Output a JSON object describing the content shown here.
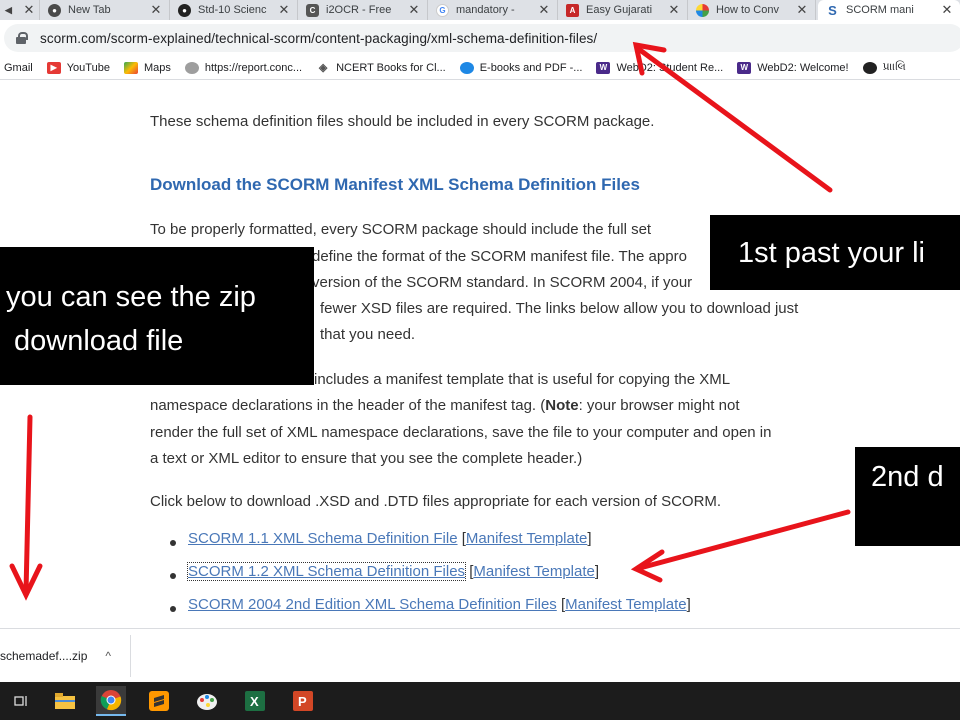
{
  "browser": {
    "tabs": [
      {
        "label": "",
        "icon": "tab-audio-icon",
        "close": "✕"
      },
      {
        "label": "New Tab",
        "icon": "chrome-icon",
        "close": "✕"
      },
      {
        "label": "Std-10 Scienc",
        "icon": "github-icon",
        "close": "✕"
      },
      {
        "label": "i2OCR - Free",
        "icon": "i2ocr-icon",
        "close": "✕"
      },
      {
        "label": "mandatory - ",
        "icon": "google-icon",
        "close": "✕"
      },
      {
        "label": "Easy Gujarati",
        "icon": "easy-gujarati-icon",
        "close": "✕"
      },
      {
        "label": "How to Conv",
        "icon": "pinwheel-icon",
        "close": "✕"
      },
      {
        "label": "SCORM mani",
        "icon": "scorm-icon",
        "close": "✕"
      }
    ],
    "url": "scorm.com/scorm-explained/technical-scorm/content-packaging/xml-schema-definition-files/",
    "bookmarks": [
      {
        "label": "Gmail",
        "icon": "gmail-icon"
      },
      {
        "label": "YouTube",
        "icon": "youtube-icon"
      },
      {
        "label": "Maps",
        "icon": "maps-icon"
      },
      {
        "label": "https://report.conc...",
        "icon": "globe-icon"
      },
      {
        "label": "NCERT Books for Cl...",
        "icon": "ncert-icon"
      },
      {
        "label": "E-books and PDF -...",
        "icon": "ebook-icon"
      },
      {
        "label": "WebD2: Student Re...",
        "icon": "webd2-icon"
      },
      {
        "label": "WebD2: Welcome!",
        "icon": "webd2-icon"
      },
      {
        "label": "પ્રાાલિ",
        "icon": "github-icon"
      }
    ]
  },
  "page": {
    "intro": "These schema definition files should be included in every SCORM package.",
    "heading": "Download the SCORM Manifest XML Schema Definition Files",
    "p1_lines": [
      "To be properly formatted, every SCORM package should include the full set",
      "define the format of the SCORM manifest file. The appro",
      "version of the SCORM standard. In SCORM 2004, if your",
      "fewer XSD files are required. The links below allow you to download just",
      "that you need."
    ],
    "p2_lines": [
      "includes a manifest template that is useful for copying the XML",
      "namespace declarations in the header of the manifest tag. (",
      "Note",
      ": your browser might not",
      "render the full set of XML namespace declarations, save the file to your computer and open in",
      "a text or XML editor to ensure that you see the complete header.)"
    ],
    "p3": "Click below to download .XSD and .DTD files appropriate for each version of SCORM.",
    "links": [
      {
        "main": "SCORM 1.1 XML Schema Definition File",
        "template": "Manifest Template"
      },
      {
        "main": "SCORM 1.2 XML Schema Definition Files",
        "template": "Manifest Template"
      },
      {
        "main": "SCORM 2004 2nd Edition XML Schema Definition Files",
        "template": "Manifest Template"
      }
    ]
  },
  "annotations": {
    "box1": "1st past your li",
    "box2_line1": "you can see the zip",
    "box2_line2": "download file",
    "box3": "2nd  d",
    "arrow_color": "#e8141b"
  },
  "download": {
    "filename": "schemadef....zip",
    "chevron": "^"
  },
  "taskbar": {
    "items": [
      "task-view-icon",
      "file-explorer-icon",
      "chrome-icon",
      "sublime-icon",
      "paint-icon",
      "excel-icon",
      "powerpoint-icon"
    ]
  }
}
